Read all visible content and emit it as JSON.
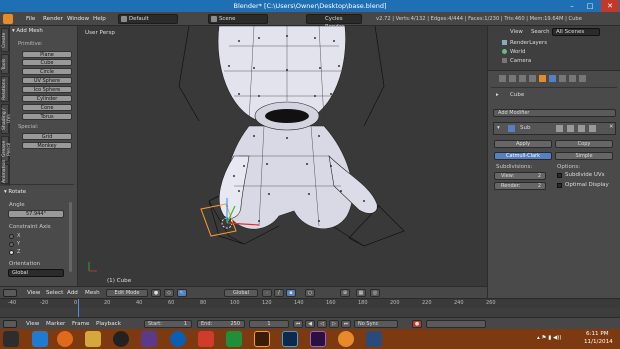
{
  "window": {
    "title": "Blender* [C:\\Users\\Owner\\Desktop\\base.blend]"
  },
  "info": {
    "menus": [
      "File",
      "Render",
      "Window",
      "Help"
    ],
    "layout": "Default",
    "scene": "Scene",
    "engine": "Cycles Render",
    "stats": "v2.72 | Verts:4/132 | Edges:4/444 | Faces:1/230 | Tris:460 | Mem:19.64M | Cube"
  },
  "toolshelf": {
    "tabs": [
      "Create",
      "Tools",
      "Relations",
      "Shading / UVs",
      "Grease Pencil",
      "Animation"
    ],
    "panel_title": "Add Mesh",
    "section_primitives": "Primitive:",
    "primitives": [
      "Plane",
      "Cube",
      "Circle",
      "UV Sphere",
      "Ico Sphere",
      "Cylinder",
      "Cone",
      "Torus"
    ],
    "section_special": "Special:",
    "special": [
      "Grid",
      "Monkey"
    ],
    "rotate_panel": "Rotate",
    "angle_label": "Angle",
    "angle_value": "57.944°",
    "constraint_label": "Constraint Axis",
    "axes": [
      "X",
      "Y",
      "Z"
    ],
    "orientation_label": "Orientation",
    "orientation_value": "Global"
  },
  "viewport": {
    "view_label": "User Persp",
    "object_label": "(1) Cube"
  },
  "view3d_header": {
    "menus": [
      "View",
      "Select",
      "Add",
      "Mesh"
    ],
    "mode": "Edit Mode",
    "orientation": "Global"
  },
  "outliner": {
    "tabs": [
      "View",
      "Search",
      "All Scenes"
    ],
    "items": [
      "RenderLayers",
      "World",
      "Camera"
    ]
  },
  "properties": {
    "object_name": "Cube",
    "add_modifier": "Add Modifier",
    "modifier_short": "Sub",
    "apply": "Apply",
    "copy": "Copy",
    "method_a": "Catmull-Clark",
    "method_b": "Simple",
    "subdivisions_label": "Subdivisions:",
    "options_label": "Options:",
    "view_label": "View:",
    "view_value": "2",
    "render_label": "Render:",
    "render_value": "2",
    "subdivide_uvs": "Subdivide UVs",
    "optimal_display": "Optimal Display"
  },
  "timeline": {
    "ticks": [
      "-40",
      "-20",
      "0",
      "20",
      "40",
      "60",
      "80",
      "100",
      "120",
      "140",
      "160",
      "180",
      "200",
      "220",
      "240",
      "260"
    ],
    "menus": [
      "View",
      "Marker",
      "Frame",
      "Playback"
    ],
    "start_label": "Start:",
    "start_value": "1",
    "end_label": "End:",
    "end_value": "250",
    "current_frame": "1",
    "sync": "No Sync"
  },
  "taskbar": {
    "time": "6:11 PM",
    "date": "11/1/2014"
  },
  "colors": {
    "title_bar": "#1f6fb5",
    "selection": "#5680c2",
    "taskbar": "#7d3a10",
    "selected_vertex": "#ff9b2f"
  }
}
